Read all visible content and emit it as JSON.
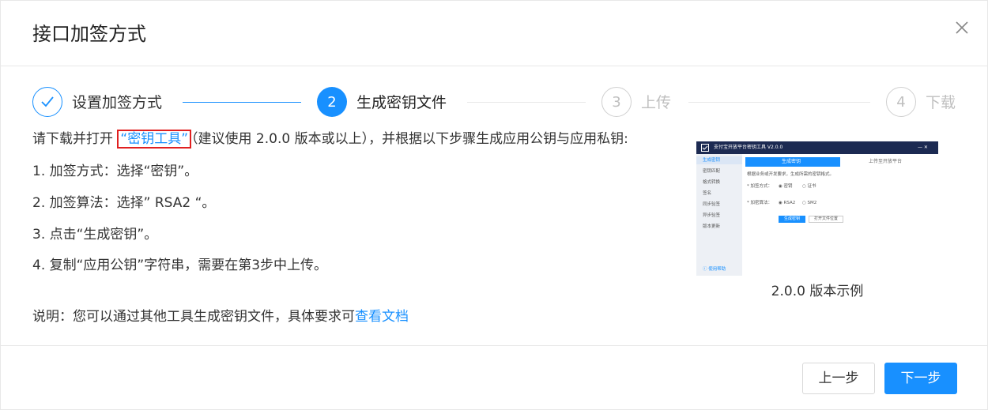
{
  "dialog": {
    "title": "接口加签方式",
    "close_icon": "close-icon"
  },
  "steps": [
    {
      "number": "",
      "label": "设置加签方式",
      "state": "done",
      "icon": "check-icon"
    },
    {
      "number": "2",
      "label": "生成密钥文件",
      "state": "active"
    },
    {
      "number": "3",
      "label": "上传",
      "state": "wait"
    },
    {
      "number": "4",
      "label": "下载",
      "state": "wait"
    }
  ],
  "content": {
    "intro_before": "请下载并打开 ",
    "intro_link": "“密钥工具”",
    "intro_after": "（建议使用 2.0.0 版本或以上），并根据以下步骤生成应用公钥与应用私钥:",
    "instructions": [
      "1. 加签方式：选择“密钥”。",
      "2. 加签算法：选择” RSA2 “。",
      "3. 点击“生成密钥”。",
      "4. 复制“应用公钥”字符串，需要在第3步中上传。"
    ],
    "note_before": "说明：您可以通过其他工具生成密钥文件，具体要求可",
    "note_link": "查看文档"
  },
  "preview": {
    "window_title": "支付宝开放平台密钥工具 V2.0.0",
    "window_controls": "— ✕",
    "sidebar_items": [
      "生成密钥",
      "密钥匹配",
      "格式转换",
      "签名",
      "同步验签",
      "异步验签",
      "版本更新"
    ],
    "sidebar_help": "ⓘ 使用帮助",
    "tab_active": "生成密钥",
    "tab_inactive": "上传至开放平台",
    "hint": "根据业务或开发要求，生成所需的密钥格式。",
    "row1_label": "* 加签方式：",
    "row1_options": [
      "◉ 密钥",
      "○ 证书"
    ],
    "row2_label": "* 加密算法：",
    "row2_options": [
      "◉ RSA2",
      "○ SM2"
    ],
    "btn_generate": "生成密钥",
    "btn_open": "打开文件位置",
    "caption": "2.0.0 版本示例"
  },
  "footer": {
    "prev_label": "上一步",
    "next_label": "下一步"
  },
  "colors": {
    "accent": "#1890ff",
    "border": "#e8e8e8",
    "highlight_box": "#e02020",
    "wait": "#bfbfbf"
  }
}
